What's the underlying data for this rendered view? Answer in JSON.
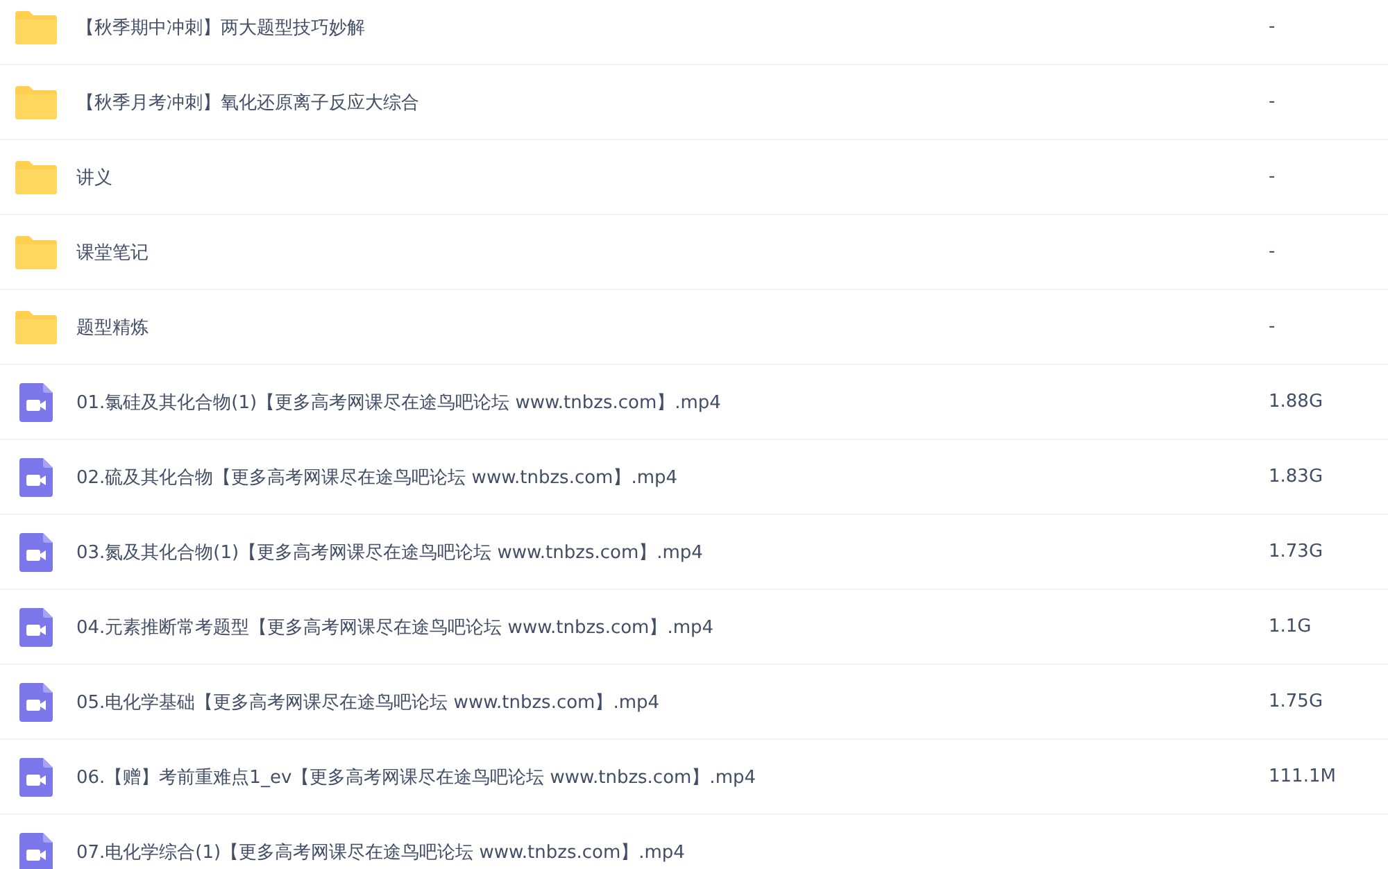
{
  "files": [
    {
      "kind": "folder",
      "name": "【秋季期中冲刺】两大题型技巧妙解",
      "size": "-"
    },
    {
      "kind": "folder",
      "name": "【秋季月考冲刺】氧化还原离子反应大综合",
      "size": "-"
    },
    {
      "kind": "folder",
      "name": "讲义",
      "size": "-"
    },
    {
      "kind": "folder",
      "name": "课堂笔记",
      "size": "-"
    },
    {
      "kind": "folder",
      "name": "题型精炼",
      "size": "-"
    },
    {
      "kind": "video",
      "name": "01.氯硅及其化合物(1)【更多高考网课尽在途鸟吧论坛 www.tnbzs.com】.mp4",
      "size": "1.88G"
    },
    {
      "kind": "video",
      "name": "02.硫及其化合物【更多高考网课尽在途鸟吧论坛 www.tnbzs.com】.mp4",
      "size": "1.83G"
    },
    {
      "kind": "video",
      "name": "03.氮及其化合物(1)【更多高考网课尽在途鸟吧论坛 www.tnbzs.com】.mp4",
      "size": "1.73G"
    },
    {
      "kind": "video",
      "name": "04.元素推断常考题型【更多高考网课尽在途鸟吧论坛 www.tnbzs.com】.mp4",
      "size": "1.1G"
    },
    {
      "kind": "video",
      "name": "05.电化学基础【更多高考网课尽在途鸟吧论坛 www.tnbzs.com】.mp4",
      "size": "1.75G"
    },
    {
      "kind": "video",
      "name": "06.【赠】考前重难点1_ev【更多高考网课尽在途鸟吧论坛 www.tnbzs.com】.mp4",
      "size": "111.1M"
    },
    {
      "kind": "video",
      "name": "07.电化学综合(1)【更多高考网课尽在途鸟吧论坛 www.tnbzs.com】.mp4"
    }
  ]
}
